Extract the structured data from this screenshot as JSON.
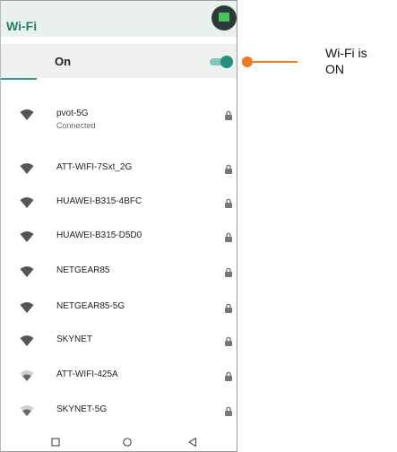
{
  "appbar": {
    "title": "Wi-Fi"
  },
  "toggle": {
    "label": "On"
  },
  "networks": [
    {
      "name": "pvot-5G",
      "status": "Connected"
    },
    {
      "name": "ATT-WIFI-7Sxt_2G"
    },
    {
      "name": "HUAWEI-B315-4BFC"
    },
    {
      "name": "HUAWEI-B315-D5D0"
    },
    {
      "name": "NETGEAR85"
    },
    {
      "name": "NETGEAR85-5G"
    },
    {
      "name": "SKYNET"
    },
    {
      "name": "ATT-WIFI-425A"
    },
    {
      "name": "SKYNET-5G"
    }
  ],
  "callout": {
    "line1": "Wi-Fi is",
    "line2": "ON"
  },
  "colors": {
    "accent": "#1f8f7f",
    "callout": "#f07a1c"
  }
}
